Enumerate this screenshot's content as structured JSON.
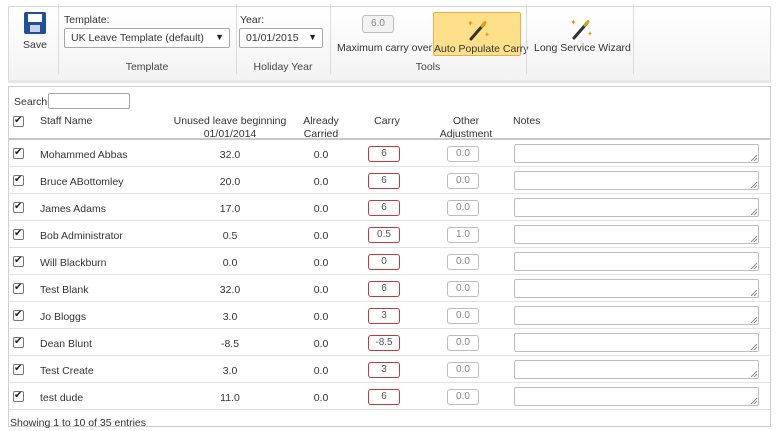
{
  "toolbar": {
    "save_label": "Save",
    "template_label": "Template:",
    "template_value": "UK Leave Template (default)",
    "template_group": "Template",
    "year_label": "Year:",
    "year_value": "01/01/2015",
    "holiday_year_group": "Holiday Year",
    "max_carry_value": "6.0",
    "max_carry_label": "Maximum carry over",
    "auto_populate_label": "Auto Populate Carry",
    "tools_group": "Tools",
    "long_service_label": "Long Service Wizard"
  },
  "search": {
    "label": "Search:",
    "value": ""
  },
  "columns": {
    "staff_name": "Staff Name",
    "unused_line1": "Unused leave beginning",
    "unused_line2": "01/01/2014",
    "already_line1": "Already",
    "already_line2": "Carried",
    "carry": "Carry",
    "other_line1": "Other",
    "other_line2": "Adjustment",
    "notes": "Notes"
  },
  "rows": [
    {
      "name": "Mohammed Abbas",
      "unused": "32.0",
      "already": "0.0",
      "carry": "6",
      "adjustment": "0.0"
    },
    {
      "name": "Bruce ABottomley",
      "unused": "20.0",
      "already": "0.0",
      "carry": "6",
      "adjustment": "0.0"
    },
    {
      "name": "James Adams",
      "unused": "17.0",
      "already": "0.0",
      "carry": "6",
      "adjustment": "0.0"
    },
    {
      "name": "Bob Administrator",
      "unused": "0.5",
      "already": "0.0",
      "carry": "0.5",
      "adjustment": "1.0"
    },
    {
      "name": "Will Blackburn",
      "unused": "0.0",
      "already": "0.0",
      "carry": "0",
      "adjustment": "0.0"
    },
    {
      "name": "Test Blank",
      "unused": "32.0",
      "already": "0.0",
      "carry": "6",
      "adjustment": "0.0"
    },
    {
      "name": "Jo Bloggs",
      "unused": "3.0",
      "already": "0.0",
      "carry": "3",
      "adjustment": "0.0"
    },
    {
      "name": "Dean Blunt",
      "unused": "-8.5",
      "already": "0.0",
      "carry": "-8.5",
      "adjustment": "0.0"
    },
    {
      "name": "Test Create",
      "unused": "3.0",
      "already": "0.0",
      "carry": "3",
      "adjustment": "0.0"
    },
    {
      "name": "test dude",
      "unused": "11.0",
      "already": "0.0",
      "carry": "6",
      "adjustment": "0.0"
    }
  ],
  "footer": {
    "info": "Showing 1 to 10 of 35 entries"
  },
  "colors": {
    "carry_border": "#c0393b",
    "active_tool_bg": "#ffe08a",
    "save_icon": "#1f4e9c"
  },
  "icons": [
    "save-icon",
    "chevron-down-icon",
    "magic-wand-icon",
    "checkbox-icon",
    "resize-handle-icon"
  ]
}
